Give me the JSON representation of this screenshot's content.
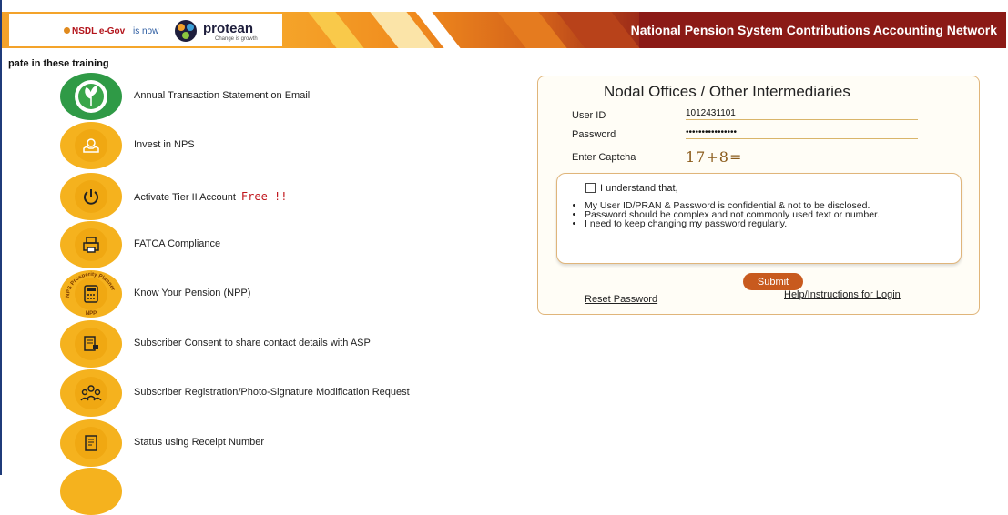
{
  "header": {
    "nsdl_text": "NSDL e-Gov",
    "is_now_text": "is now",
    "brand": "protean",
    "tagline": "Change is growth",
    "title": "National Pension System Contributions Accounting Network"
  },
  "intro_text": "pate in these training",
  "services": [
    {
      "label": "Annual Transaction Statement on Email",
      "icon": "go-green-icon"
    },
    {
      "label": "Invest in NPS",
      "icon": "hands-money-icon"
    },
    {
      "label": "Activate Tier II Account",
      "extra": "Free !!",
      "icon": "power-icon"
    },
    {
      "label": "FATCA Compliance",
      "icon": "printer-icon"
    },
    {
      "label": "Know Your Pension (NPP)",
      "icon": "calculator-icon",
      "badge_top": "NPS Prosperity Planner",
      "badge_bottom": "NPP"
    },
    {
      "label": "Subscriber Consent to share contact details with ASP",
      "icon": "document-share-icon"
    },
    {
      "label": "Subscriber Registration/Photo-Signature Modification Request",
      "icon": "people-group-icon"
    },
    {
      "label": "Status using Receipt Number",
      "icon": "receipt-icon"
    }
  ],
  "login": {
    "title": "Nodal Offices / Other Intermediaries",
    "user_id_label": "User ID",
    "user_id_value": "1012431101",
    "password_label": "Password",
    "password_value": "••••••••••••••••",
    "captcha_label": "Enter Captcha",
    "captcha_text": "17+8=",
    "terms_heading": "I understand that,",
    "terms": [
      "My User ID/PRAN & Password is confidential & not to be disclosed.",
      "Password should be complex and not commonly used text or number.",
      "I need to keep changing my password regularly."
    ],
    "submit_label": "Submit",
    "reset_label": "Reset Password",
    "help_label": "Help/Instructions for Login"
  },
  "colors": {
    "header_dark": "#8b1a16",
    "header_orange": "#f3a22a",
    "icon_yellow": "#f5b21e",
    "submit_bg": "#c85a1e",
    "free_text": "#c0141b"
  }
}
